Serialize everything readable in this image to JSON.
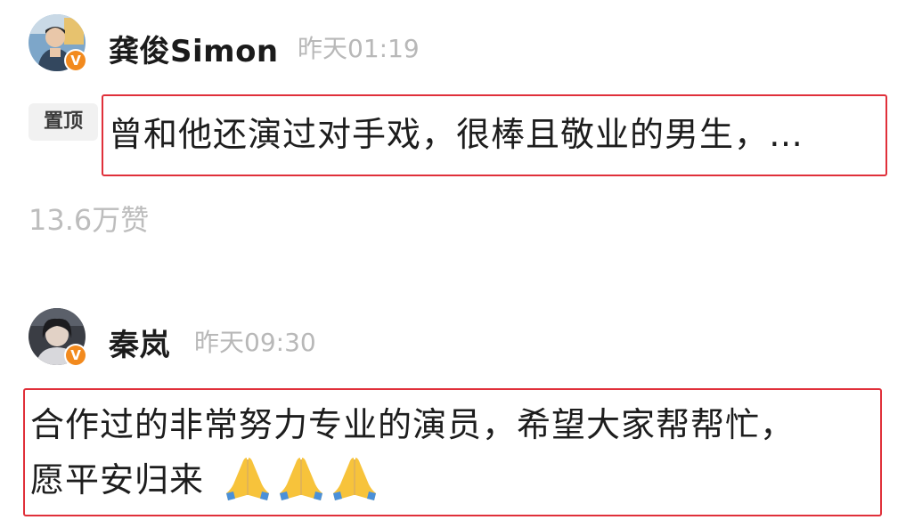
{
  "comments": [
    {
      "username": "龚俊Simon",
      "timestamp": "昨天01:19",
      "pinned_label": "置顶",
      "text": "曾和他还演过对手戏，很棒且敬业的男生，…",
      "likes": "13.6万赞",
      "verified": true,
      "avatar_icon": "user-avatar-photo"
    },
    {
      "username": "秦岚",
      "timestamp": "昨天09:30",
      "text_lines": [
        "合作过的非常努力专业的演员，希望大家帮帮忙，",
        "愿平安归来"
      ],
      "emoji": [
        "folded-hands",
        "folded-hands",
        "folded-hands"
      ],
      "verified": true,
      "avatar_icon": "user-avatar-photo"
    }
  ],
  "colors": {
    "highlight_border": "#e0303a",
    "verified_badge": "#f28a1e",
    "timestamp": "#b8b8b8",
    "pin_badge_bg": "#f1f1f1"
  }
}
